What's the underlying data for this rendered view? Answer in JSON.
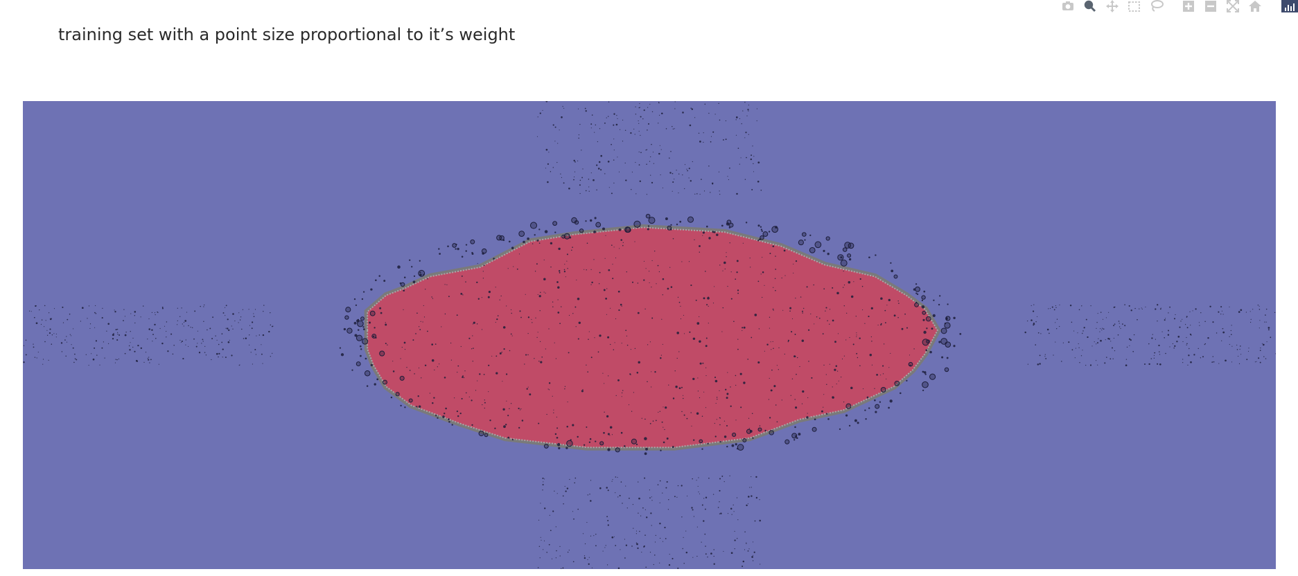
{
  "title": "training set with a point size proportional to it’s weight",
  "modebar": {
    "buttons": [
      {
        "name": "camera-icon",
        "active": false
      },
      {
        "name": "zoom-icon",
        "active": true
      },
      {
        "name": "pan-icon",
        "active": false
      },
      {
        "name": "box-select-icon",
        "active": false
      },
      {
        "name": "lasso-select-icon",
        "active": false
      },
      {
        "name": "zoom-in-icon",
        "active": false
      },
      {
        "name": "zoom-out-icon",
        "active": false
      },
      {
        "name": "autoscale-icon",
        "active": false
      },
      {
        "name": "reset-axes-icon",
        "active": false
      }
    ]
  },
  "colors": {
    "outer_region": "#6e72b4",
    "inner_region": "#c04b67",
    "boundary": "#7a7a7a",
    "point": "#1c1d3a"
  },
  "chart_data": {
    "type": "scatter",
    "title": "training set with a point size proportional to it’s weight",
    "xlabel": "",
    "ylabel": "",
    "xlim": [
      -1,
      1
    ],
    "ylim": [
      -1,
      1
    ],
    "grid": false,
    "legend": "none",
    "background": "decision-region contour",
    "regions": [
      {
        "label": "outer",
        "color": "#6e72b4"
      },
      {
        "label": "inner ellipse",
        "color": "#c04b67"
      }
    ],
    "decision_boundary": [
      [
        -0.45,
        0.02
      ],
      [
        -0.45,
        0.1
      ],
      [
        -0.42,
        0.17
      ],
      [
        -0.39,
        0.2
      ],
      [
        -0.35,
        0.25
      ],
      [
        -0.27,
        0.29
      ],
      [
        -0.19,
        0.4
      ],
      [
        -0.12,
        0.43
      ],
      [
        -0.01,
        0.46
      ],
      [
        0.12,
        0.44
      ],
      [
        0.21,
        0.38
      ],
      [
        0.28,
        0.3
      ],
      [
        0.36,
        0.25
      ],
      [
        0.41,
        0.17
      ],
      [
        0.44,
        0.11
      ],
      [
        0.46,
        0.02
      ],
      [
        0.44,
        -0.08
      ],
      [
        0.42,
        -0.15
      ],
      [
        0.39,
        -0.22
      ],
      [
        0.31,
        -0.32
      ],
      [
        0.24,
        -0.36
      ],
      [
        0.16,
        -0.44
      ],
      [
        0.04,
        -0.48
      ],
      [
        -0.1,
        -0.48
      ],
      [
        -0.23,
        -0.44
      ],
      [
        -0.3,
        -0.38
      ],
      [
        -0.38,
        -0.3
      ],
      [
        -0.42,
        -0.22
      ],
      [
        -0.44,
        -0.13
      ],
      [
        -0.45,
        -0.06
      ]
    ],
    "series": [
      {
        "cluster": "left band",
        "center": [
          -0.8,
          0.0
        ],
        "spread": [
          0.2,
          0.13
        ],
        "count": 260,
        "weight_range": [
          0.5,
          1.2
        ]
      },
      {
        "cluster": "right band",
        "center": [
          0.8,
          0.0
        ],
        "spread": [
          0.2,
          0.13
        ],
        "count": 260,
        "weight_range": [
          0.5,
          1.2
        ]
      },
      {
        "cluster": "top band",
        "center": [
          0.0,
          0.8
        ],
        "spread": [
          0.18,
          0.2
        ],
        "count": 230,
        "weight_range": [
          0.5,
          1.2
        ]
      },
      {
        "cluster": "bottom band",
        "center": [
          0.0,
          -0.8
        ],
        "spread": [
          0.18,
          0.2
        ],
        "count": 230,
        "weight_range": [
          0.5,
          1.2
        ]
      },
      {
        "cluster": "ellipse interior",
        "center": [
          0.0,
          0.0
        ],
        "spread": [
          0.44,
          0.45
        ],
        "count": 620,
        "weight_range": [
          0.5,
          1.6
        ]
      },
      {
        "cluster": "boundary ring",
        "center": [
          0.0,
          0.0
        ],
        "spread": [
          0.47,
          0.48
        ],
        "count": 320,
        "weight_range": [
          1.0,
          4.0
        ]
      }
    ]
  }
}
